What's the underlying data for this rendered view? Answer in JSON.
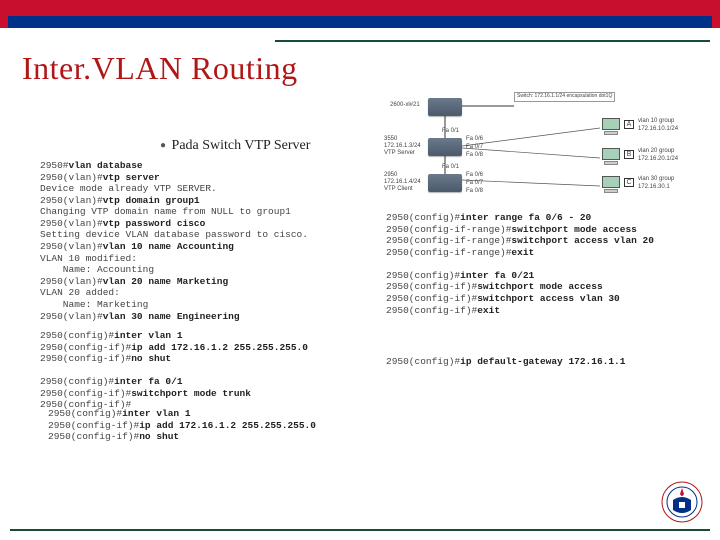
{
  "header": {
    "title": "Inter.VLAN Routing"
  },
  "bullet": {
    "text": "Pada Switch VTP Server"
  },
  "diagram": {
    "switches": [
      {
        "id": "sw0",
        "label": "2600-xl#21"
      },
      {
        "id": "sw1",
        "label_ip": "172.16.1.3/24",
        "label_name": "VTP Server",
        "label_model": "3550",
        "ports_up": "Fa 0/1",
        "ports_rt": [
          "Fa 0/6",
          "Fa 0/7",
          "Fa 0/8"
        ]
      },
      {
        "id": "sw2",
        "label_ip": "172.16.1.4/24",
        "label_name": "VTP Client",
        "label_model": "2950",
        "label_port": "Fa 0/1",
        "ports_rt": [
          "Fa 0/6",
          "Fa 0/7",
          "Fa 0/8"
        ]
      }
    ],
    "pcs": [
      {
        "tag": "A",
        "vlan": "vlan 10 group",
        "ip": "172.16.10.1/24"
      },
      {
        "tag": "B",
        "vlan": "vlan 20 group",
        "ip": "172.16.20.1/24"
      },
      {
        "tag": "C",
        "vlan": "vlan 30 group",
        "ip": "172.16.30.1"
      }
    ],
    "cross_label": "Switch: 172.16.1.1/24\nencapsulation dot1Q"
  },
  "cli": {
    "left1": [
      {
        "p": "2950#",
        "c": "vlan database"
      },
      {
        "p": "2950(vlan)#",
        "c": "vtp server"
      },
      {
        "t": "Device mode already VTP SERVER."
      },
      {
        "p": "2950(vlan)#",
        "c": "vtp domain group1"
      },
      {
        "t": "Changing VTP domain name from NULL to group1"
      },
      {
        "p": "2950(vlan)#",
        "c": "vtp password cisco"
      },
      {
        "t": "Setting device VLAN database password to cisco."
      },
      {
        "p": "2950(vlan)#",
        "c": "vlan 10 name Accounting"
      },
      {
        "t": "VLAN 10 modified:"
      },
      {
        "t": "    Name: Accounting"
      },
      {
        "p": "2950(vlan)#",
        "c": "vlan 20 name Marketing"
      },
      {
        "t": "VLAN 20 added:"
      },
      {
        "t": "    Name: Marketing"
      },
      {
        "p": "2950(vlan)#",
        "c": "vlan 30 name Engineering"
      }
    ],
    "right1": [
      {
        "p": "2950(config)#",
        "c": "inter range fa 0/6 - 20"
      },
      {
        "p": "2950(config-if-range)#",
        "c": "switchport mode access"
      },
      {
        "p": "2950(config-if-range)#",
        "c": "switchport access vlan 20"
      },
      {
        "p": "2950(config-if-range)#",
        "c": "exit"
      },
      {
        "t": ""
      },
      {
        "p": "2950(config)#",
        "c": "inter fa 0/21"
      },
      {
        "p": "2950(config-if)#",
        "c": "switchport mode access"
      },
      {
        "p": "2950(config-if)#",
        "c": "switchport access vlan 30"
      },
      {
        "p": "2950(config-if)#",
        "c": "exit"
      }
    ],
    "left2": [
      {
        "p": "2950(config)#",
        "c": "inter vlan 1"
      },
      {
        "p": "2950(config-if)#",
        "c": "ip add 172.16.1.2 255.255.255.0"
      },
      {
        "p": "2950(config-if)#",
        "c": "no shut"
      },
      {
        "t": ""
      },
      {
        "p": "2950(config)#",
        "c": "inter fa 0/1"
      },
      {
        "p": "2950(config-if)#",
        "c": "switchport mode trunk"
      },
      {
        "p": "2950(config-if)#"
      }
    ],
    "right2": [
      {
        "p": "2950(config)#",
        "c": "ip default-gateway 172.16.1.1"
      }
    ],
    "left3": [
      {
        "p": "2950(config)#",
        "c": "inter vlan 1"
      },
      {
        "p": "2950(config-if)#",
        "c": "ip add 172.16.1.2 255.255.255.0"
      },
      {
        "p": "2950(config-if)#",
        "c": "no shut"
      }
    ]
  }
}
